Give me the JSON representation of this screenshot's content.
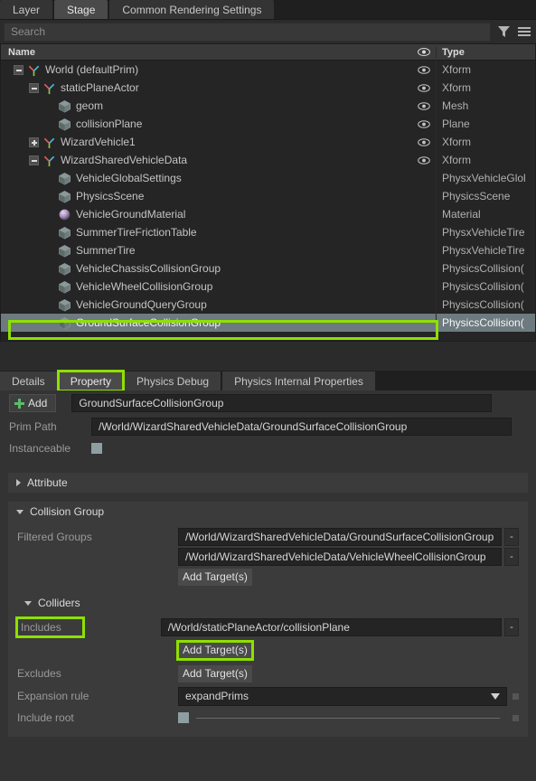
{
  "top_tabs": [
    {
      "label": "Layer",
      "active": false
    },
    {
      "label": "Stage",
      "active": true
    },
    {
      "label": "Common Rendering Settings",
      "active": false
    }
  ],
  "search": {
    "placeholder": "Search",
    "value": "",
    "filter_icon": "funnel-icon",
    "menu_icon": "hamburger-icon"
  },
  "tree": {
    "columns": {
      "name": "Name",
      "type": "Type"
    },
    "rows": [
      {
        "label": "World (defaultPrim)",
        "type": "Xform",
        "depth": 1,
        "expander": "minus",
        "icon": "xform-axis-icon",
        "eye": true,
        "selected": false
      },
      {
        "label": "staticPlaneActor",
        "type": "Xform",
        "depth": 2,
        "expander": "minus",
        "icon": "xform-axis-icon",
        "eye": true,
        "selected": false
      },
      {
        "label": "geom",
        "type": "Mesh",
        "depth": 3,
        "expander": "none",
        "icon": "cube-icon",
        "eye": true,
        "selected": false
      },
      {
        "label": "collisionPlane",
        "type": "Plane",
        "depth": 3,
        "expander": "none",
        "icon": "cube-icon",
        "eye": true,
        "selected": false
      },
      {
        "label": "WizardVehicle1",
        "type": "Xform",
        "depth": 2,
        "expander": "plus",
        "icon": "xform-axis-icon",
        "eye": true,
        "selected": false
      },
      {
        "label": "WizardSharedVehicleData",
        "type": "Xform",
        "depth": 2,
        "expander": "minus",
        "icon": "xform-axis-icon",
        "eye": true,
        "selected": false
      },
      {
        "label": "VehicleGlobalSettings",
        "type": "PhysxVehicleGlol",
        "depth": 3,
        "expander": "none",
        "icon": "cube-icon",
        "eye": false,
        "selected": false
      },
      {
        "label": "PhysicsScene",
        "type": "PhysicsScene",
        "depth": 3,
        "expander": "none",
        "icon": "cube-icon",
        "eye": false,
        "selected": false
      },
      {
        "label": "VehicleGroundMaterial",
        "type": "Material",
        "depth": 3,
        "expander": "none",
        "icon": "material-sphere-icon",
        "eye": false,
        "selected": false
      },
      {
        "label": "SummerTireFrictionTable",
        "type": "PhysxVehicleTire",
        "depth": 3,
        "expander": "none",
        "icon": "cube-icon",
        "eye": false,
        "selected": false
      },
      {
        "label": "SummerTire",
        "type": "PhysxVehicleTire",
        "depth": 3,
        "expander": "none",
        "icon": "cube-icon",
        "eye": false,
        "selected": false
      },
      {
        "label": "VehicleChassisCollisionGroup",
        "type": "PhysicsCollision(",
        "depth": 3,
        "expander": "none",
        "icon": "cube-icon",
        "eye": false,
        "selected": false
      },
      {
        "label": "VehicleWheelCollisionGroup",
        "type": "PhysicsCollision(",
        "depth": 3,
        "expander": "none",
        "icon": "cube-icon",
        "eye": false,
        "selected": false
      },
      {
        "label": "VehicleGroundQueryGroup",
        "type": "PhysicsCollision(",
        "depth": 3,
        "expander": "none",
        "icon": "cube-icon",
        "eye": false,
        "selected": false
      },
      {
        "label": "GroundSurfaceCollisionGroup",
        "type": "PhysicsCollision(",
        "depth": 3,
        "expander": "none",
        "icon": "cube-icon",
        "eye": false,
        "selected": true
      }
    ]
  },
  "panel_tabs": [
    {
      "label": "Details",
      "active": false,
      "highlighted": false
    },
    {
      "label": "Property",
      "active": true,
      "highlighted": true
    },
    {
      "label": "Physics Debug",
      "active": false,
      "highlighted": false
    },
    {
      "label": "Physics Internal Properties",
      "active": false,
      "highlighted": false
    }
  ],
  "property": {
    "add_label": "Add",
    "prim_name": "GroundSurfaceCollisionGroup",
    "prim_path_label": "Prim Path",
    "prim_path_value": "/World/WizardSharedVehicleData/GroundSurfaceCollisionGroup",
    "instanceable_label": "Instanceable",
    "attribute_section": "Attribute",
    "collision_group_section": "Collision Group",
    "filtered_groups_label": "Filtered Groups",
    "filtered_groups": [
      "/World/WizardSharedVehicleData/GroundSurfaceCollisionGroup",
      "/World/WizardSharedVehicleData/VehicleWheelCollisionGroup"
    ],
    "filtered_add_target": "Add Target(s)",
    "colliders_section": "Colliders",
    "includes_label": "Includes",
    "includes": [
      "/World/staticPlaneActor/collisionPlane"
    ],
    "includes_add_target": "Add Target(s)",
    "excludes_label": "Excludes",
    "excludes_add_target": "Add Target(s)",
    "expansion_rule_label": "Expansion rule",
    "expansion_rule_value": "expandPrims",
    "include_root_label": "Include root",
    "remove_symbol": "-"
  },
  "colors": {
    "highlight": "#8ee000",
    "selection": "#6d7b80",
    "accent_green": "#5dbb6a"
  }
}
